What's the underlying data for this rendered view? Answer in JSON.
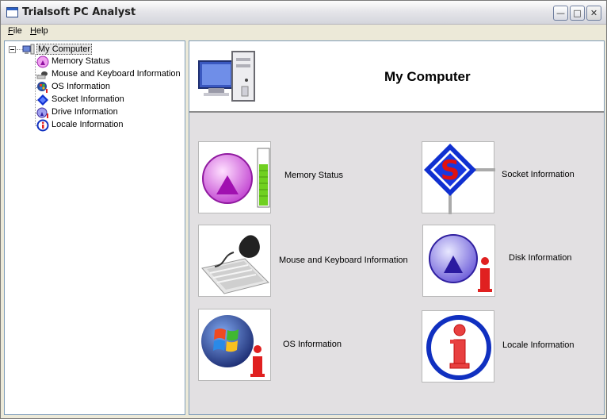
{
  "window": {
    "title": "Trialsoft PC Analyst"
  },
  "menu": [
    {
      "label": "File",
      "mnemonic": "F",
      "rest": "ile"
    },
    {
      "label": "Help",
      "mnemonic": "H",
      "rest": "elp"
    }
  ],
  "tree": {
    "root": "My Computer",
    "items": [
      {
        "label": "Memory Status",
        "icon": "memory-icon"
      },
      {
        "label": "Mouse and Keyboard Information",
        "icon": "mouse-icon"
      },
      {
        "label": "OS Information",
        "icon": "windows-icon"
      },
      {
        "label": "Socket Information",
        "icon": "socket-icon"
      },
      {
        "label": "Drive Information",
        "icon": "disk-icon"
      },
      {
        "label": "Locale Information",
        "icon": "info-icon"
      }
    ]
  },
  "main": {
    "title": "My Computer",
    "tiles": [
      {
        "label": "Memory Status",
        "icon": "memory-icon"
      },
      {
        "label": "Socket Information",
        "icon": "socket-icon"
      },
      {
        "label": "Mouse and Keyboard Information",
        "icon": "mouse-keyboard-icon"
      },
      {
        "label": "Disk Information",
        "icon": "disk-icon"
      },
      {
        "label": "OS Information",
        "icon": "windows-icon"
      },
      {
        "label": "Locale Information",
        "icon": "info-icon"
      }
    ]
  },
  "colors": {
    "accent_purple": "#b020c0",
    "socket_blue": "#1030d0",
    "socket_red": "#e01010",
    "info_red": "#e02020"
  }
}
